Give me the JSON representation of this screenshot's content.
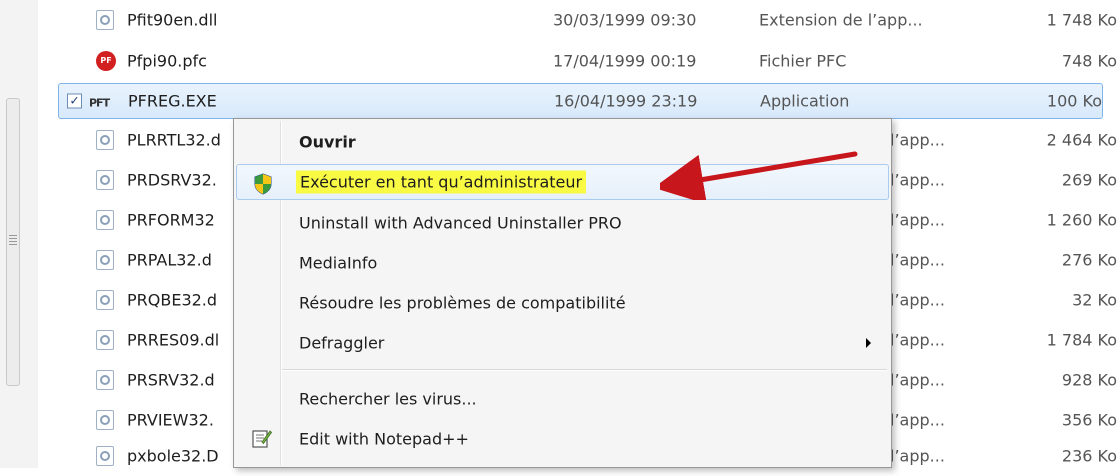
{
  "files": [
    {
      "name": "Pfit90en.dll",
      "date": "30/03/1999 09:30",
      "type": "Extension de l’app...",
      "size": "1 748 Ko",
      "icon": "dll-icon"
    },
    {
      "name": "Pfpi90.pfc",
      "date": "17/04/1999 00:19",
      "type": "Fichier PFC",
      "size": "748 Ko",
      "icon": "pfc-icon"
    },
    {
      "name": "PFREG.EXE",
      "date": "16/04/1999 23:19",
      "type": "Application",
      "size": "100 Ko",
      "icon": "pft-icon",
      "selected": true
    },
    {
      "name": "PLRRTL32.d",
      "type": "l’app...",
      "size": "2 464 Ko",
      "icon": "dll-icon"
    },
    {
      "name": "PRDSRV32.",
      "type": "l’app...",
      "size": "269 Ko",
      "icon": "dll-icon"
    },
    {
      "name": "PRFORM32",
      "type": "l’app...",
      "size": "1 260 Ko",
      "icon": "dll-icon"
    },
    {
      "name": "PRPAL32.d",
      "type": "l’app...",
      "size": "276 Ko",
      "icon": "dll-icon"
    },
    {
      "name": "PRQBE32.d",
      "type": "l’app...",
      "size": "32 Ko",
      "icon": "dll-icon"
    },
    {
      "name": "PRRES09.dl",
      "type": "l’app...",
      "size": "1 784 Ko",
      "icon": "dll-icon"
    },
    {
      "name": "PRSRV32.d",
      "type": "l’app...",
      "size": "928 Ko",
      "icon": "dll-icon"
    },
    {
      "name": "PRVIEW32.",
      "type": "l’app...",
      "size": "356 Ko",
      "icon": "dll-icon"
    },
    {
      "name": "pxbole32.D",
      "type": "l’app...",
      "size": "236 Ko",
      "icon": "dll-icon"
    }
  ],
  "pft_icon_text": "PFT",
  "pfc_icon_text": "PF",
  "checkbox_mark": "✓",
  "menu": {
    "open": "Ouvrir",
    "run_as_admin": "Exécuter en tant qu’administrateur",
    "uninstall": "Uninstall with Advanced Uninstaller PRO",
    "mediainfo": "MediaInfo",
    "compat": "Résoudre les problèmes de compatibilité",
    "defraggler": "Defraggler",
    "scan": "Rechercher les virus...",
    "notepad": "Edit with Notepad++"
  },
  "colors": {
    "highlight": "#f8fa44",
    "selection_border": "#7eb4ea",
    "arrow": "#c8161d"
  }
}
